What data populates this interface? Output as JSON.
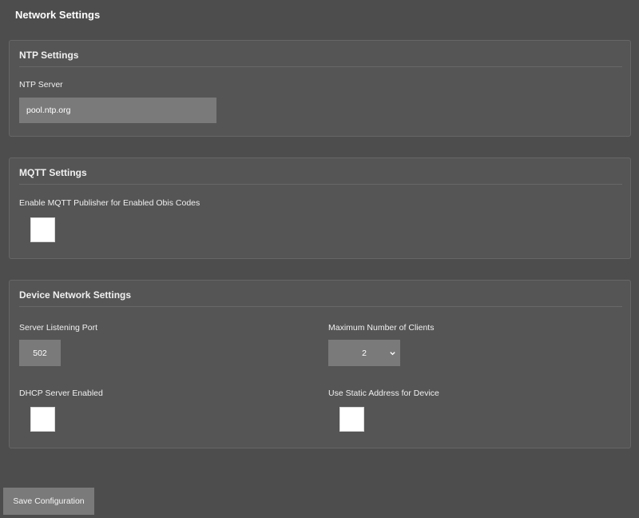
{
  "page": {
    "title": "Network Settings"
  },
  "ntp": {
    "title": "NTP Settings",
    "server_label": "NTP Server",
    "server_value": "pool.ntp.org"
  },
  "mqtt": {
    "title": "MQTT Settings",
    "enable_label": "Enable MQTT Publisher for Enabled Obis Codes",
    "enable_checked": false
  },
  "device_network": {
    "title": "Device Network Settings",
    "port_label": "Server Listening Port",
    "port_value": "502",
    "max_clients_label": "Maximum Number of Clients",
    "max_clients_value": "2",
    "dhcp_label": "DHCP Server Enabled",
    "dhcp_checked": false,
    "static_label": "Use Static Address for Device",
    "static_checked": false
  },
  "actions": {
    "save_label": "Save Configuration"
  },
  "icons": {
    "dropdown": "chevron-down-icon"
  },
  "colors": {
    "background": "#4d4d4d",
    "panel": "#555555",
    "input": "#7a7a7a",
    "text": "#ffffff"
  }
}
